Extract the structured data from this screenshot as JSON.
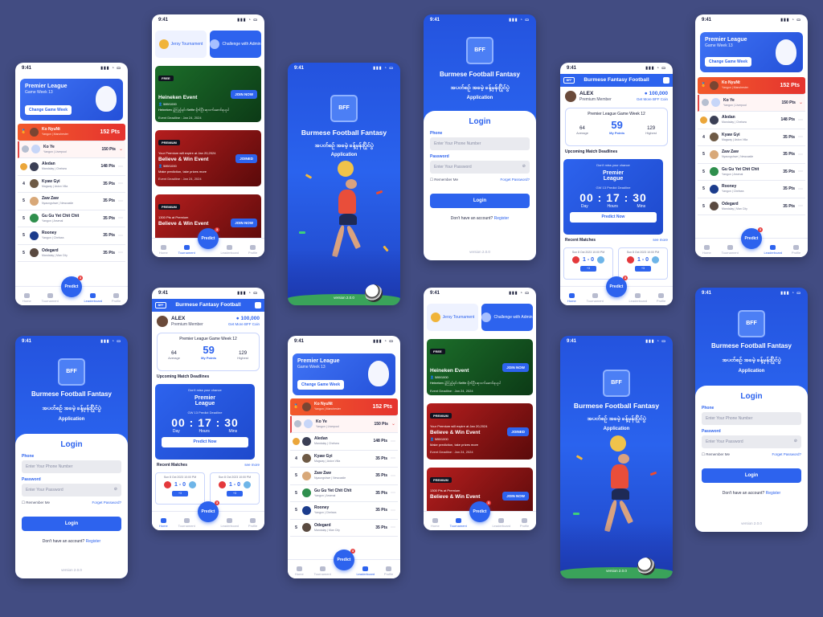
{
  "statusbar": {
    "time": "9:41"
  },
  "nav": {
    "home": "Home",
    "tournament": "Tournament",
    "predict": "Predict",
    "leaderboard": "Leaderboard",
    "profile": "Profile",
    "badge": "3"
  },
  "leaderboard": {
    "league": "Premier League",
    "week": "Game Week 13",
    "change_week": "Change Game Week",
    "highlight": {
      "name": "Ko NyuNt",
      "sub": "Yangon | Manchester",
      "points": "152 Pts"
    },
    "rows": [
      {
        "rank": "1",
        "name": "Ko Ye",
        "sub": "Yangon | Liverpool",
        "points": "150 Pts"
      },
      {
        "rank": "2",
        "name": "Aledan",
        "sub": "Mandalay | Chelsea",
        "points": "148 Pts"
      },
      {
        "rank": "4",
        "name": "Kyaw Gyi",
        "sub": "Magway | Aston Villa",
        "points": "35 Pts"
      },
      {
        "rank": "5",
        "name": "Zaw Zaw",
        "sub": "Nyaungshwe | Newcastle",
        "points": "35 Pts"
      },
      {
        "rank": "5",
        "name": "Gu Gu Yet Chit Chit",
        "sub": "Yangon | Arsenal",
        "points": "35 Pts"
      },
      {
        "rank": "5",
        "name": "Rooney",
        "sub": "Yangon | Chelsea",
        "points": "35 Pts"
      },
      {
        "rank": "5",
        "name": "Odegard",
        "sub": "Mandalay | Man City",
        "points": "35 Pts"
      }
    ]
  },
  "tournament": {
    "tab1": "Jersy Tournament",
    "tab2": "Challenge with Admin",
    "events": [
      {
        "tag": "FREE",
        "title": "Heineken Event",
        "stat": "589/1000",
        "sub": "Heineken ပွဲကြည့်ရင်း Selfie ရိုက်ပြီး ဆုလက်ဆောင်ရယူပါ",
        "deadline": "Event Deadline : Jan 24, 2024",
        "btn": "JOIN NOW"
      },
      {
        "tag": "PREMIUM",
        "title": "Believe & Win Event",
        "stat": "589/1000",
        "sub": "Make prediction, take prizes more",
        "deadline": "Event Deadline : Jan 24, 2024",
        "btn": "JOINED",
        "note": "Your Premium will expire at Jan 20,2024"
      },
      {
        "tag": "PREMIUM",
        "title": "Believe & Win Event",
        "note": "1300 Pts at Premium",
        "btn": "JOIN NOW"
      }
    ]
  },
  "splash": {
    "title": "Burmese Football Fantasy",
    "myanmar": "အပတ်စဉ် အခမဲ့ ခန့်မှန်းပြိုင်ပွဲ",
    "sub": "Application",
    "logo": "BFF",
    "version": "version 2.0.0"
  },
  "login": {
    "title": "Login",
    "phone_label": "Phone",
    "phone_placeholder": "Enter Your Phone Number",
    "password_label": "Password",
    "password_placeholder": "Enter Your Password",
    "remember": "Remember Me",
    "forgot": "Forget Password?",
    "button": "Login",
    "no_account": "Don't have an account?",
    "register": "Register",
    "version": "version 2.0.0"
  },
  "home": {
    "app_title": "Burmese Fantasy Football",
    "badge": "BFF",
    "user": "ALEX",
    "role": "Premium Member",
    "coins": "100,000",
    "get_more": "Get More BFF Coin",
    "gw_title": "Premier League Game Week 12",
    "average": "64",
    "average_label": "Average",
    "my_points": "59",
    "my_points_label": "My Points",
    "highest": "129",
    "highest_label": "Highest",
    "upcoming": "Upcoming Match Deadlines",
    "dont_miss": "Don't miss your chance",
    "league_line1": "Premier",
    "league_line2": "League",
    "gw13": "GW 13 Predict Deadline",
    "countdown": "00 : 17 : 30",
    "day": "Day",
    "hours": "Hours",
    "mins": "Mins",
    "predict_now": "Predict Now",
    "recent": "Recent Matches",
    "see_more": "see more",
    "matches": [
      {
        "date": "Sun 8 Oct 2023 10:00 PM",
        "score": "1 - 0",
        "pts": "+3"
      },
      {
        "date": "Sun 8 Oct 2023 10:00 PM",
        "score": "1 - 0",
        "pts": "+3"
      }
    ]
  },
  "colors": {
    "bg": "#424c82",
    "primary": "#2d63ee",
    "highlight": "#ee4a2d"
  }
}
